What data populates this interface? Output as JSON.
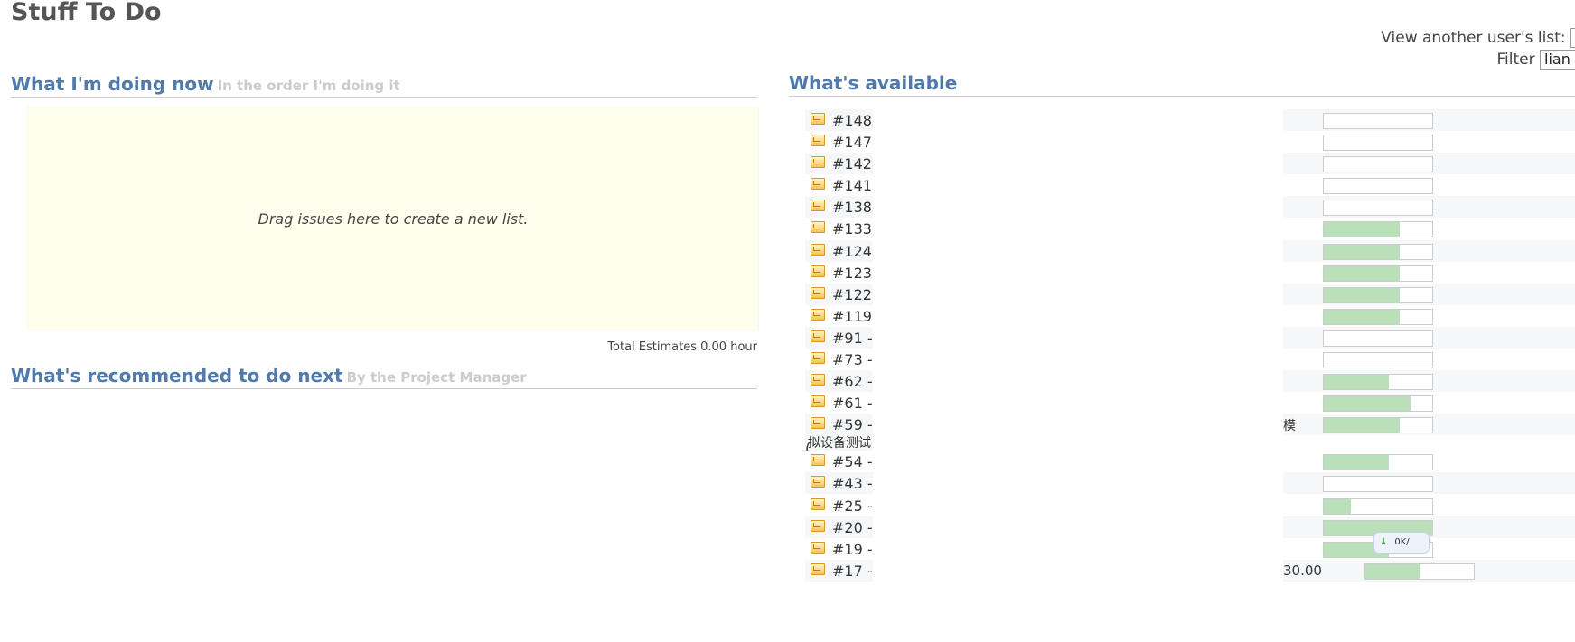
{
  "page": {
    "title": "Stuff To Do"
  },
  "user_select": {
    "label": "View another user's list:",
    "filter_label": "Filter",
    "filter_value": "lian"
  },
  "sections": {
    "now": {
      "title": "What I'm doing now",
      "subtitle": "In the order I'm doing it"
    },
    "next": {
      "title": "What's recommended to do next",
      "subtitle": "By the Project Manager"
    },
    "available": {
      "title": "What's available"
    }
  },
  "drop_zone": {
    "text": "Drag issues here to create a new list."
  },
  "total_estimates": "Total Estimates 0.00 hour",
  "issues": [
    {
      "id": "#148 -",
      "progress": 0
    },
    {
      "id": "#147 -",
      "progress": 0
    },
    {
      "id": "#142 -",
      "progress": 0
    },
    {
      "id": "#141 -",
      "progress": 0
    },
    {
      "id": "#138 -",
      "progress": 0
    },
    {
      "id": "#133 -",
      "progress": 0.7
    },
    {
      "id": "#124 -",
      "progress": 0.7
    },
    {
      "id": "#123 -",
      "progress": 0.7
    },
    {
      "id": "#122 -",
      "progress": 0.7
    },
    {
      "id": "#119 -",
      "progress": 0.7
    },
    {
      "id": "#91 - (",
      "progress": 0
    },
    {
      "id": "#73 - Z",
      "progress": 0
    },
    {
      "id": "#62 - Z",
      "progress": 0.6
    },
    {
      "id": "#61 - Z",
      "progress": 0.8
    },
    {
      "id": "#59 - (",
      "line2": "拟设备测试​",
      "right_text": "​模",
      "progress": 0.7
    },
    {
      "id": "#54 - Z",
      "progress": 0.6
    },
    {
      "id": "#43 - (",
      "progress": 0
    },
    {
      "id": "#25 - (",
      "progress": 0.25
    },
    {
      "id": "#20 - (",
      "progress": 1.0
    },
    {
      "id": "#19 - (",
      "progress": 0.6
    },
    {
      "id": "#17 - (",
      "estimate": "30.00",
      "progress": 0.5
    }
  ],
  "float_badge": {
    "text": "0K/",
    "arrow": "↓"
  },
  "colors": {
    "title_blue": "#507aaa",
    "progress_fill": "#bae0ba",
    "drop_zone_bg": "#ffffee"
  }
}
